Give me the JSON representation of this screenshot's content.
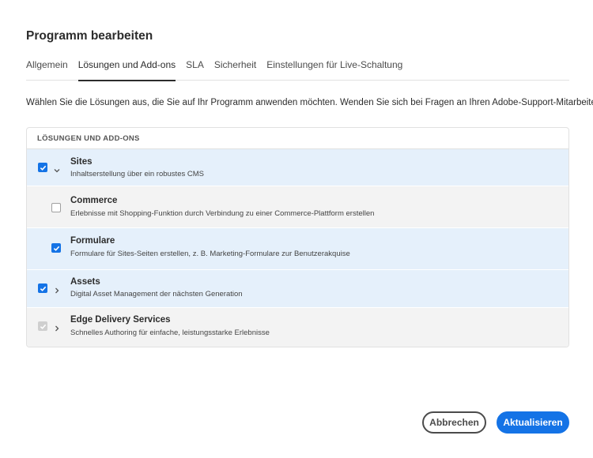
{
  "dialog": {
    "title": "Programm bearbeiten",
    "description": "Wählen Sie die Lösungen aus, die Sie auf Ihr Programm anwenden möchten. Wenden Sie sich bei Fragen an Ihren Adobe-Support-Mitarbeiter."
  },
  "tabs": [
    {
      "label": "Allgemein",
      "active": false
    },
    {
      "label": "Lösungen und Add-ons",
      "active": true
    },
    {
      "label": "SLA",
      "active": false
    },
    {
      "label": "Sicherheit",
      "active": false
    },
    {
      "label": "Einstellungen für Live-Schaltung",
      "active": false
    }
  ],
  "table": {
    "header": "LÖSUNGEN UND ADD-ONS",
    "rows": [
      {
        "title": "Sites",
        "subtitle": "Inhaltserstellung über ein robustes CMS",
        "checked": true,
        "expander": "chevron-down-icon"
      },
      {
        "title": "Commerce",
        "subtitle": "Erlebnisse mit Shopping-Funktion durch Verbindung zu einer Commerce-Plattform erstellen",
        "checked": false
      },
      {
        "title": "Formulare",
        "subtitle": "Formulare für Sites-Seiten erstellen, z. B. Marketing-Formulare zur Benutzerakquise",
        "checked": true
      },
      {
        "title": "Assets",
        "subtitle": "Digital Asset Management der nächsten Generation",
        "checked": true,
        "expander": "chevron-right-icon"
      },
      {
        "title": "Edge Delivery Services",
        "subtitle": "Schnelles Authoring für einfache, leistungsstarke Erlebnisse",
        "checked": true,
        "disabled": true,
        "expander": "chevron-right-icon"
      }
    ]
  },
  "footer": {
    "cancel_label": "Abbrechen",
    "submit_label": "Aktualisieren"
  },
  "colors": {
    "accent": "#1473e6",
    "selected_row": "#e5f0fb",
    "unselected_row": "#f3f3f3"
  }
}
